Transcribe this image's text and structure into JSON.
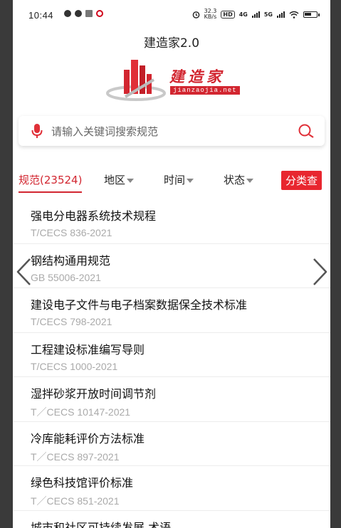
{
  "status_bar": {
    "time": "10:44",
    "speed_value": "32.3",
    "speed_unit": "KB/s",
    "hd_badge": "HD",
    "net1": "4G",
    "net2": "5G",
    "battery": "61"
  },
  "app": {
    "title": "建造家2.0",
    "logo_text": "建造家",
    "logo_url": "jianzaojia.net"
  },
  "search": {
    "placeholder": "请输入关键词搜索规范"
  },
  "filters": {
    "active_tab": "规范(23524)",
    "region": "地区",
    "time": "时间",
    "status": "状态",
    "classify_button": "分类查"
  },
  "items": [
    {
      "title": "强电分电器系统技术规程",
      "code": "T/CECS 836-2021"
    },
    {
      "title": "钢结构通用规范",
      "code": "GB 55006-2021"
    },
    {
      "title": "建设电子文件与电子档案数据保全技术标准",
      "code": "T/CECS 798-2021"
    },
    {
      "title": "工程建设标准编写导则",
      "code": "T/CECS 1000-2021"
    },
    {
      "title": "湿拌砂浆开放时间调节剂",
      "code": "T／CECS 10147-2021"
    },
    {
      "title": "冷库能耗评价方法标准",
      "code": "T／CECS 897-2021"
    },
    {
      "title": "绿色科技馆评价标准",
      "code": "T／CECS 851-2021"
    },
    {
      "title": "城市和社区可持续发展 术语",
      "code": ""
    }
  ],
  "colors": {
    "accent": "#d22630",
    "button": "#e8262f"
  }
}
